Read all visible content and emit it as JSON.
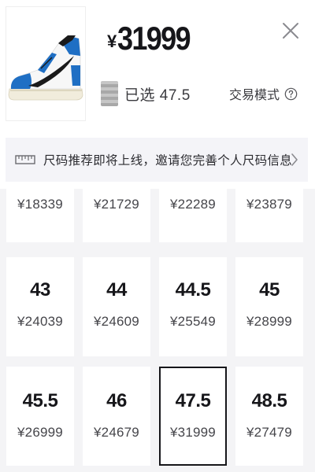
{
  "header": {
    "currency": "¥",
    "price": "31999",
    "selected_label": "已选 47.5",
    "trade_mode": "交易模式"
  },
  "banner": {
    "text": "尺码推荐即将上线，邀请您完善个人尺码信息"
  },
  "sizes": [
    {
      "size": "",
      "price": "¥18339"
    },
    {
      "size": "",
      "price": "¥21729"
    },
    {
      "size": "",
      "price": "¥22289"
    },
    {
      "size": "",
      "price": "¥23879"
    },
    {
      "size": "43",
      "price": "¥24039"
    },
    {
      "size": "44",
      "price": "¥24609"
    },
    {
      "size": "44.5",
      "price": "¥25549"
    },
    {
      "size": "45",
      "price": "¥28999"
    },
    {
      "size": "45.5",
      "price": "¥26999"
    },
    {
      "size": "46",
      "price": "¥24679"
    },
    {
      "size": "47.5",
      "price": "¥31999",
      "selected": true
    },
    {
      "size": "48.5",
      "price": "¥27479"
    }
  ],
  "colors": {
    "text": "#16161a",
    "muted": "#45454a",
    "banner_bg": "#f4f4f8",
    "grid_bg": "#f4f4f6",
    "sneaker_blue": "#1f6fc4",
    "sneaker_black": "#1a1a1a",
    "sneaker_cream": "#f1ecdc"
  },
  "icons": {
    "close": "close-icon",
    "help": "help-circle-icon",
    "ruler": "ruler-icon",
    "chevron": "chevron-right-icon",
    "product": "sneaker-image"
  }
}
